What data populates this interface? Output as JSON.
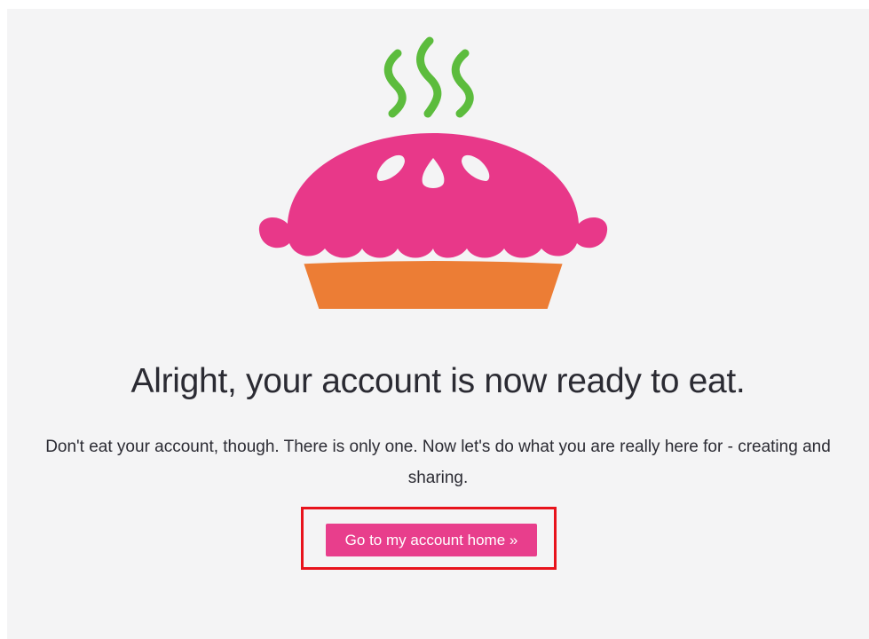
{
  "hero": {
    "headline": "Alright, your account is now ready to eat.",
    "subtext": "Don't eat your account, though. There is only one. Now let's do what you are really here for - creating and sharing."
  },
  "cta": {
    "label": "Go to my account home »"
  },
  "icons": {
    "hero_image": "pie-icon",
    "steam": "steam-icon"
  },
  "colors": {
    "page_background": "#f4f4f5",
    "pie_crust": "#e83889",
    "pie_dish": "#ec7d35",
    "steam": "#5cbc3d",
    "button": "#e83e8c",
    "highlight": "#e8131c"
  }
}
